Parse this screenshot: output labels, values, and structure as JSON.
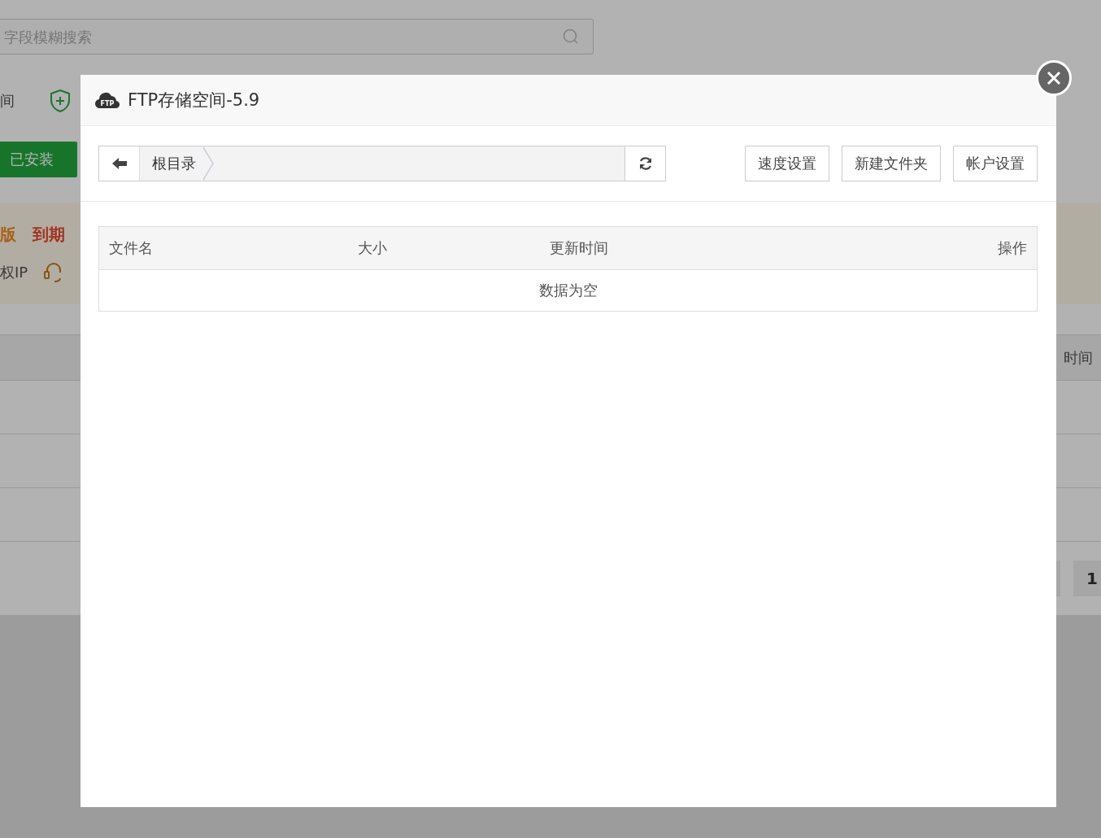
{
  "background": {
    "search": {
      "placeholder": "字段模糊搜索"
    },
    "info_label": "间",
    "installed_button": "已安装",
    "edition": "版",
    "expiry_label": "到期",
    "auth_ip_label": "权IP",
    "table_header_right": "时间",
    "pagination": [
      "1"
    ]
  },
  "dialog": {
    "title_icon_text": "FTP",
    "title": "FTP存储空间-5.9",
    "breadcrumb": [
      {
        "label": "根目录"
      }
    ],
    "buttons": [
      "速度设置",
      "新建文件夹",
      "帐户设置"
    ],
    "table": {
      "columns": [
        "文件名",
        "大小",
        "更新时间",
        "操作"
      ],
      "empty_text": "数据为空"
    }
  }
}
